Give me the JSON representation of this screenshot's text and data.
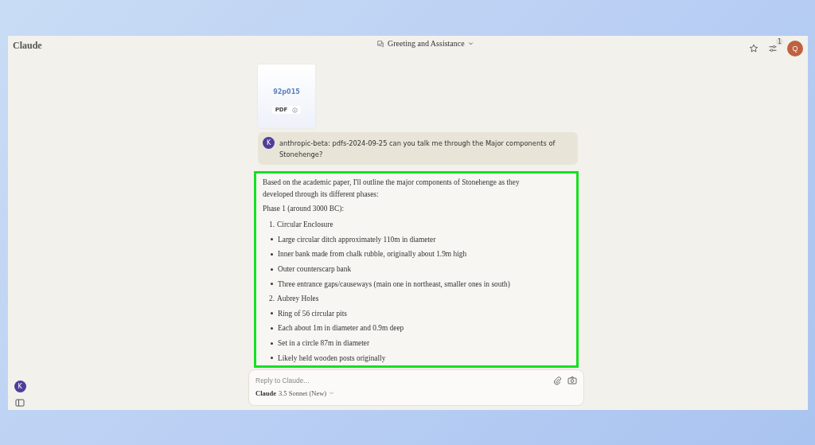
{
  "app": {
    "name": "Claude"
  },
  "header": {
    "title": "Greeting and Assistance",
    "badge": "1",
    "avatar": "Q"
  },
  "attachment": {
    "name": "92p015",
    "type": "PDF"
  },
  "user_message": {
    "avatar": "K",
    "text": "anthropic-beta: pdfs-2024-09-25 can you talk me through the Major components of Stonehenge?"
  },
  "response": {
    "highlighted": true,
    "intro": "Based on the academic paper, I'll outline the major components of Stonehenge as they developed through its different phases:",
    "heading": "Phase 1 (around 3000 BC):",
    "items": [
      {
        "kind": "numbered",
        "number": "1.",
        "text": "Circular Enclosure"
      },
      {
        "kind": "bullet",
        "text": "Large circular ditch approximately 110m in diameter"
      },
      {
        "kind": "bullet",
        "text": "Inner bank made from chalk rubble, originally about 1.9m high"
      },
      {
        "kind": "bullet",
        "text": "Outer counterscarp bank"
      },
      {
        "kind": "bullet",
        "text": "Three entrance gaps/causeways (main one in northeast, smaller ones in south)"
      },
      {
        "kind": "numbered",
        "number": "2.",
        "text": "Aubrey Holes"
      },
      {
        "kind": "bullet",
        "text": "Ring of 56 circular pits"
      },
      {
        "kind": "bullet",
        "text": "Each about 1m in diameter and 0.9m deep"
      },
      {
        "kind": "bullet",
        "text": "Set in a circle 87m in diameter"
      },
      {
        "kind": "bullet",
        "text": "Likely held wooden posts originally"
      }
    ]
  },
  "sidebar": {
    "avatar": "K"
  },
  "composer": {
    "placeholder": "Reply to Claude...",
    "model_name": "Claude",
    "model_version": "3.5 Sonnet (New)"
  }
}
